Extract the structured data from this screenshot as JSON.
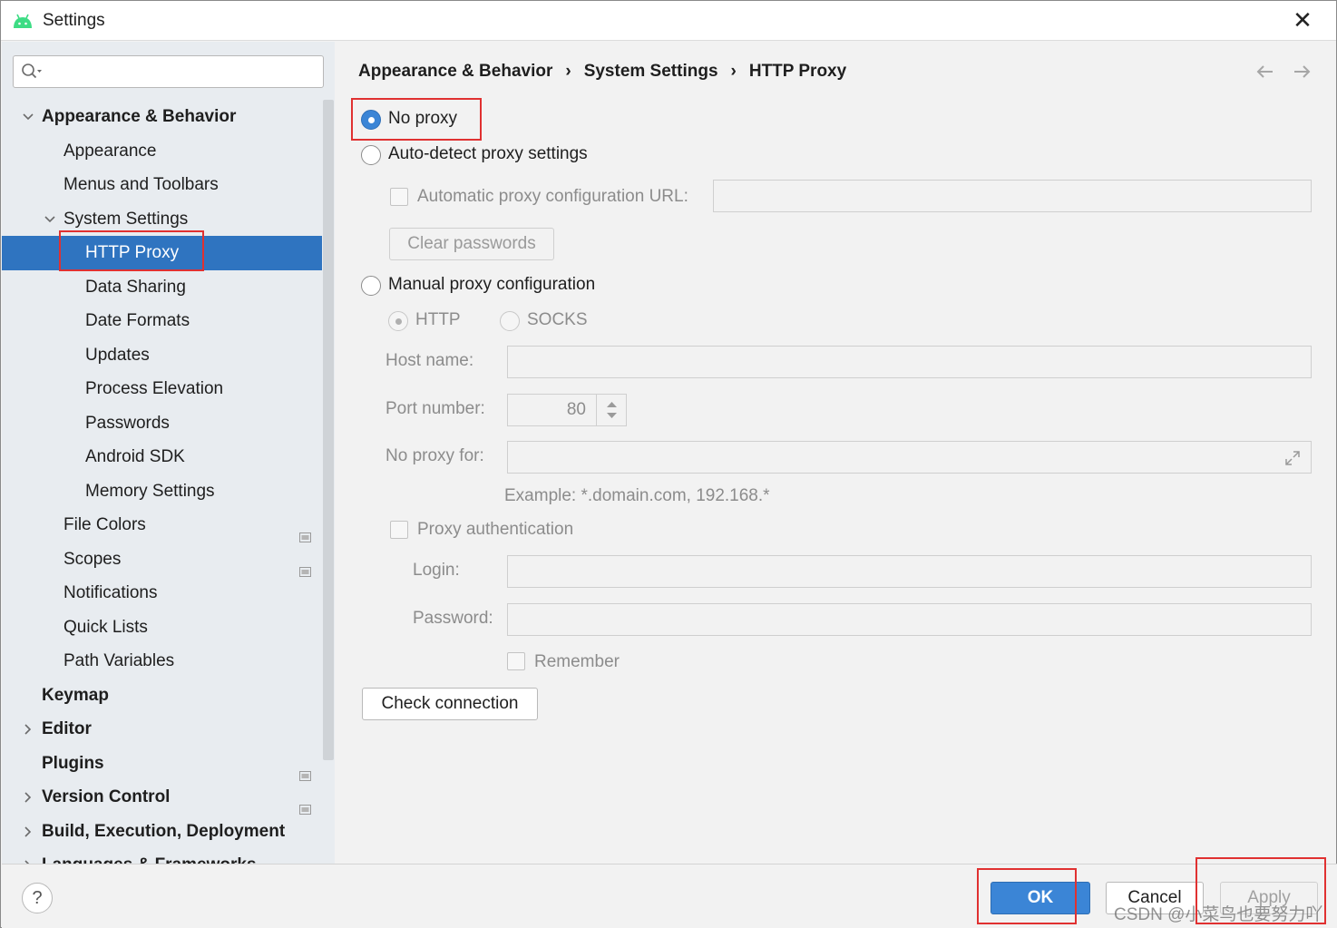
{
  "window": {
    "title": "Settings"
  },
  "search": {
    "value": "",
    "placeholder": ""
  },
  "sidebar": {
    "items": [
      {
        "label": "Appearance & Behavior",
        "bold": true,
        "expanded": true
      },
      {
        "label": "Appearance"
      },
      {
        "label": "Menus and Toolbars"
      },
      {
        "label": "System Settings",
        "expanded": true
      },
      {
        "label": "HTTP Proxy",
        "selected": true
      },
      {
        "label": "Data Sharing"
      },
      {
        "label": "Date Formats"
      },
      {
        "label": "Updates"
      },
      {
        "label": "Process Elevation"
      },
      {
        "label": "Passwords"
      },
      {
        "label": "Android SDK"
      },
      {
        "label": "Memory Settings"
      },
      {
        "label": "File Colors",
        "badge": "project-settings-icon"
      },
      {
        "label": "Scopes",
        "badge": "project-settings-icon"
      },
      {
        "label": "Notifications"
      },
      {
        "label": "Quick Lists"
      },
      {
        "label": "Path Variables"
      },
      {
        "label": "Keymap",
        "bold": true
      },
      {
        "label": "Editor",
        "bold": true,
        "expanded": false
      },
      {
        "label": "Plugins",
        "bold": true,
        "badge": "project-settings-icon"
      },
      {
        "label": "Version Control",
        "bold": true,
        "expanded": false,
        "badge": "project-settings-icon"
      },
      {
        "label": "Build, Execution, Deployment",
        "bold": true,
        "expanded": false
      },
      {
        "label": "Languages & Frameworks",
        "bold": true,
        "expanded": false
      }
    ]
  },
  "breadcrumb": [
    "Appearance & Behavior",
    "System Settings",
    "HTTP Proxy"
  ],
  "breadcrumb_separator": "›",
  "nav": {
    "back_icon": "arrow-left-icon",
    "forward_icon": "arrow-right-icon"
  },
  "proxy": {
    "no_proxy_label": "No proxy",
    "auto_detect_label": "Auto-detect proxy settings",
    "auto_config_url_label": "Automatic proxy configuration URL:",
    "auto_config_url_value": "",
    "clear_passwords_label": "Clear passwords",
    "manual_label": "Manual proxy configuration",
    "http_label": "HTTP",
    "socks_label": "SOCKS",
    "host_label": "Host name:",
    "host_value": "",
    "port_label": "Port number:",
    "port_value": "80",
    "no_proxy_for_label": "No proxy for:",
    "no_proxy_for_value": "",
    "example_text": "Example: *.domain.com, 192.168.*",
    "proxy_auth_label": "Proxy authentication",
    "login_label": "Login:",
    "login_value": "",
    "password_label": "Password:",
    "password_value": "",
    "remember_label": "Remember",
    "check_connection_label": "Check connection",
    "selected": "No proxy"
  },
  "footer": {
    "help_label": "?",
    "ok_label": "OK",
    "cancel_label": "Cancel",
    "apply_label": "Apply",
    "watermark": "CSDN @小菜鸟也要努力吖"
  },
  "colors": {
    "selection": "#2f74c0",
    "ok_button": "#3b85d6",
    "highlight_box": "#e03131",
    "sidebar_bg": "#e8ecf0"
  }
}
